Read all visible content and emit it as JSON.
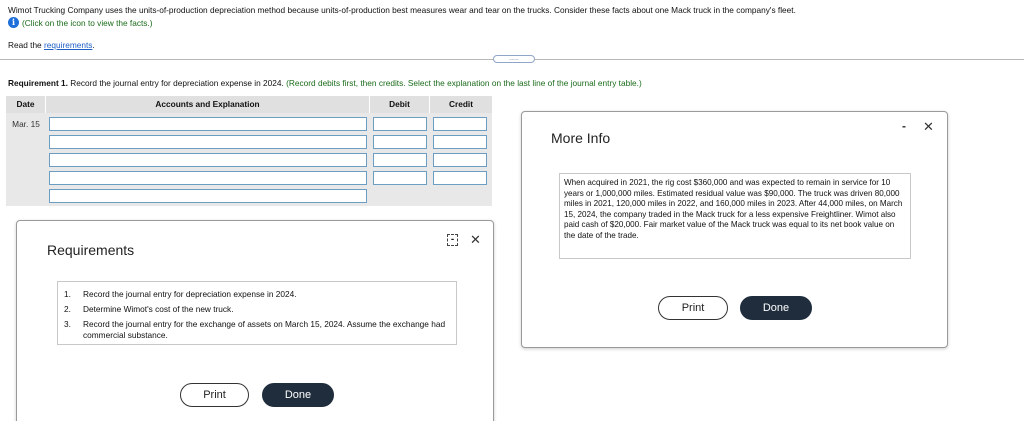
{
  "intro": {
    "text": "Wimot Trucking Company uses the units-of-production depreciation method because units-of-production best measures wear and tear on the trucks. Consider these facts about one Mack truck in the company's fleet.",
    "icon_hint": "(Click on the icon to view the facts.)",
    "read_prefix": "Read the",
    "read_link": "requirements",
    "read_suffix": "."
  },
  "divider": {
    "handle_label": "....."
  },
  "requirement1": {
    "label": "Requirement 1.",
    "text": "Record the journal entry for depreciation expense in 2024.",
    "hint": "(Record debits first, then credits. Select the explanation on the last line of the journal entry table.)"
  },
  "journal": {
    "headers": {
      "date": "Date",
      "accounts": "Accounts and Explanation",
      "debit": "Debit",
      "credit": "Credit"
    },
    "date_value": "Mar. 15",
    "rows": [
      {
        "account": "",
        "debit": "",
        "credit": ""
      },
      {
        "account": "",
        "debit": "",
        "credit": ""
      },
      {
        "account": "",
        "debit": "",
        "credit": ""
      },
      {
        "account": "",
        "debit": "",
        "credit": ""
      },
      {
        "account": ""
      }
    ]
  },
  "requirements_modal": {
    "title": "Requirements",
    "min_label": "-",
    "close_label": "✕",
    "items": [
      {
        "num": "1.",
        "text": "Record the journal entry for depreciation expense in 2024."
      },
      {
        "num": "2.",
        "text": "Determine Wimot's cost of the new truck."
      },
      {
        "num": "3.",
        "text": "Record the journal entry for the exchange of assets on March 15, 2024. Assume the exchange had commercial substance."
      }
    ],
    "print_label": "Print",
    "done_label": "Done"
  },
  "info_modal": {
    "title": "More Info",
    "min_label": "-",
    "close_label": "✕",
    "text": "When acquired in 2021, the rig cost $360,000 and was expected to remain in service for 10 years or 1,000,000 miles. Estimated residual value was $90,000. The truck was driven 80,000 miles in 2021, 120,000 miles in 2022, and 160,000 miles in 2023. After 44,000 miles, on March 15, 2024, the company traded in the Mack truck for a less expensive Freightliner. Wimot also paid cash of $20,000. Fair market value of the Mack truck was equal to its net book value on the date of the trade.",
    "print_label": "Print",
    "done_label": "Done"
  },
  "colors": {
    "accent_blue": "#1e6fd9",
    "hint_green": "#1a6b1a",
    "done_button": "#1f2d3d",
    "input_border": "#6c9ec4"
  },
  "icons": {
    "info": "info-icon",
    "minimize": "minimize-icon",
    "close": "close-icon"
  }
}
